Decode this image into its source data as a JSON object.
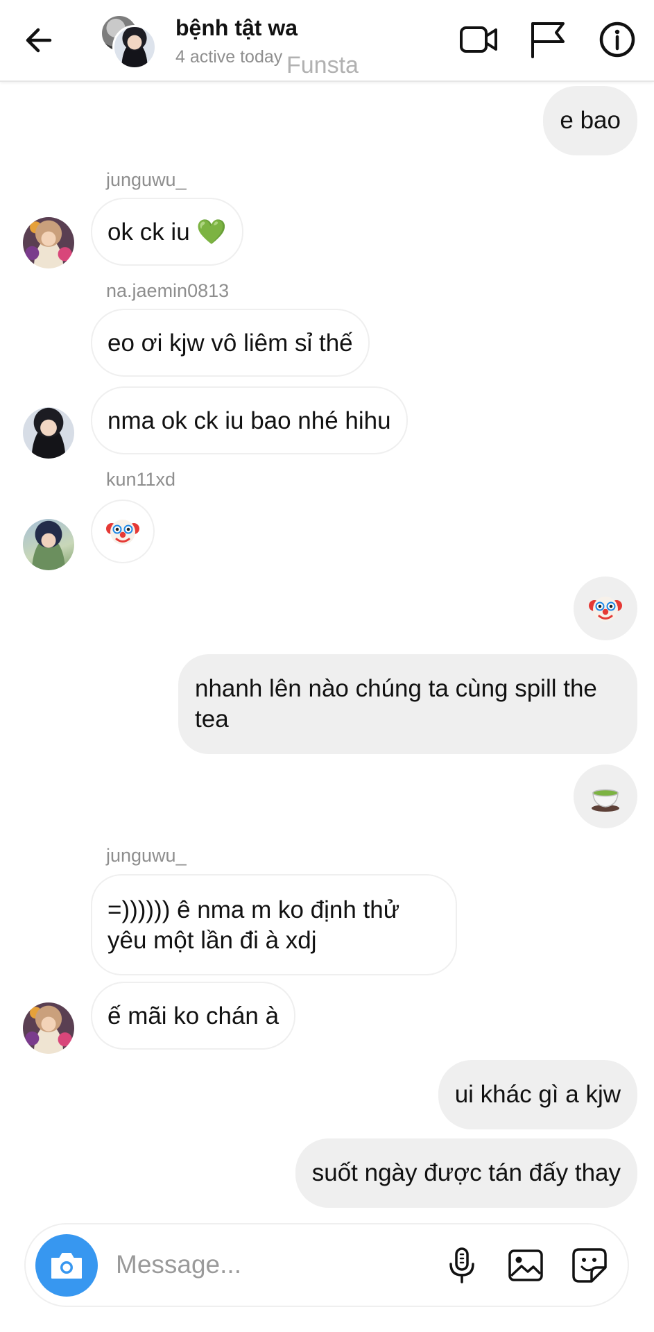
{
  "header": {
    "back_icon": "arrow-left-icon",
    "title": "bệnh tật wa",
    "status": "4 active today",
    "watermark": "Funsta",
    "actions": [
      "video-call-icon",
      "flag-icon",
      "info-icon"
    ]
  },
  "messages": [
    {
      "direction": "out",
      "type": "text",
      "text": "e bao"
    },
    {
      "direction": "in",
      "sender": "junguwu_",
      "type": "text",
      "text": "ok ck iu 💚"
    },
    {
      "direction": "in",
      "sender": "na.jaemin0813",
      "type": "text",
      "text": "eo ơi kjw vô liêm sỉ thế"
    },
    {
      "direction": "in",
      "type": "text",
      "text": "nma ok ck iu bao nhé hihu"
    },
    {
      "direction": "in",
      "sender": "kun11xd",
      "type": "emoji",
      "text": "clown-face-emoji"
    },
    {
      "direction": "out",
      "type": "emoji",
      "text": "clown-face-emoji"
    },
    {
      "direction": "out",
      "type": "text",
      "text": "nhanh lên nào chúng ta cùng spill the tea"
    },
    {
      "direction": "out",
      "type": "emoji",
      "text": "teacup-emoji"
    },
    {
      "direction": "in",
      "sender": "junguwu_",
      "type": "text",
      "text": "=)))))) ê nma m ko định thử yêu một lần đi à xdj"
    },
    {
      "direction": "in",
      "type": "text",
      "text": "ế mãi ko chán à"
    },
    {
      "direction": "out",
      "type": "text",
      "text": "ui khác gì a kjw"
    },
    {
      "direction": "out",
      "type": "text",
      "text": "suốt ngày được tán đấy thay"
    }
  ],
  "composer": {
    "placeholder": "Message...",
    "value": "",
    "camera_icon": "camera-icon",
    "accent_color": "#3797f0",
    "icons": [
      "microphone-icon",
      "gallery-icon",
      "sticker-icon"
    ]
  },
  "colors": {
    "outgoing_bubble": "#efefef",
    "incoming_bubble_border": "#efefef",
    "secondary_text": "#8e8e8e"
  }
}
